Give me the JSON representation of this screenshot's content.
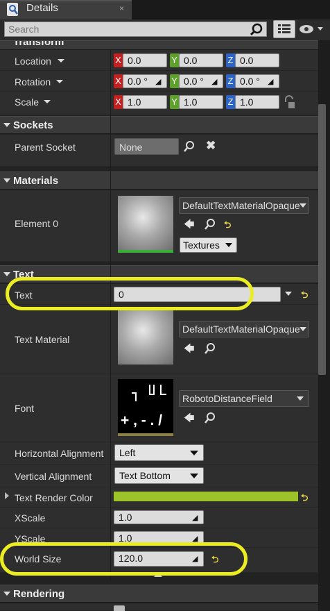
{
  "tab": {
    "title": "Details",
    "close": "×"
  },
  "search": {
    "placeholder": "Search"
  },
  "transform": {
    "title": "Transform",
    "location": {
      "label": "Location",
      "x": "0.0",
      "y": "0.0",
      "z": "0.0"
    },
    "rotation": {
      "label": "Rotation",
      "x": "0.0 °",
      "y": "0.0 °",
      "z": "0.0 °"
    },
    "scale": {
      "label": "Scale",
      "x": "1.0",
      "y": "1.0",
      "z": "1.0"
    },
    "axes": {
      "x": "X",
      "y": "Y",
      "z": "Z"
    }
  },
  "sockets": {
    "title": "Sockets",
    "parent_label": "Parent Socket",
    "parent_value": "None"
  },
  "materials": {
    "title": "Materials",
    "element_label": "Element 0",
    "material_value": "DefaultTextMaterialOpaque",
    "textures_label": "Textures"
  },
  "text": {
    "title": "Text",
    "text_label": "Text",
    "text_value": "0",
    "material_label": "Text Material",
    "material_value": "DefaultTextMaterialOpaque",
    "font_label": "Font",
    "font_value": "RobotoDistanceField",
    "font_preview": "+ , - . /",
    "halign_label": "Horizontal Alignment",
    "halign_value": "Left",
    "valign_label": "Vertical Alignment",
    "valign_value": "Text Bottom",
    "color_label": "Text Render Color",
    "render_color": "#9cc32a",
    "xscale_label": "XScale",
    "xscale_value": "1.0",
    "yscale_label": "YScale",
    "yscale_value": "1.0",
    "worldsize_label": "World Size",
    "worldsize_value": "120.0"
  },
  "rendering": {
    "title": "Rendering"
  },
  "colors": {
    "highlight": "#ecec22",
    "axis_x": "#c42020",
    "axis_y": "#5da12a",
    "axis_z": "#2b63c8"
  }
}
